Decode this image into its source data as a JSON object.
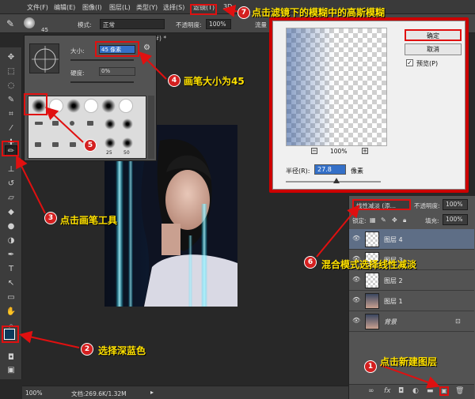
{
  "menubar": {
    "items": [
      "文件(F)",
      "编辑(E)",
      "图像(I)",
      "图层(L)",
      "类型(Y)",
      "选择(S)",
      "滤镜(T)",
      "3D"
    ]
  },
  "options": {
    "brush_size": "45",
    "mode_label": "模式:",
    "mode_value": "正常",
    "opacity_label": "不透明度:",
    "opacity_value": "100%",
    "flow_label": "流量"
  },
  "document": {
    "tab": "8#) *"
  },
  "brush_panel": {
    "size_label": "大小:",
    "size_value": "45 像素",
    "hardness_label": "硬度:",
    "hardness_value": "0%",
    "sizes": [
      "25",
      "50"
    ]
  },
  "gaussian_dialog": {
    "ok": "确定",
    "cancel": "取消",
    "preview": "预览(P)",
    "zoom": "100%",
    "radius_label": "半径(R):",
    "radius_value": "27.8",
    "radius_unit": "像素"
  },
  "layers_panel": {
    "blend_mode": "线性减淡 (添...",
    "opacity_label": "不透明度:",
    "opacity_value": "100%",
    "lock_label": "锁定:",
    "fill_label": "填充:",
    "fill_value": "100%",
    "layers": [
      {
        "name": "图层 4",
        "selected": true
      },
      {
        "name": "图层 3",
        "selected": false
      },
      {
        "name": "图层 2",
        "selected": false
      },
      {
        "name": "图层 1",
        "selected": false
      },
      {
        "name": "背景",
        "selected": false
      }
    ]
  },
  "status": {
    "zoom": "100%",
    "doc": "文档:269.6K/1.32M"
  },
  "annotations": {
    "n1": "1",
    "t1": "点击新建图层",
    "n2": "2",
    "t2": "选择深蓝色",
    "n3": "3",
    "t3": "点击画笔工具",
    "n4": "4",
    "t4": "画笔大小为45",
    "n5": "5",
    "n6": "6",
    "t6": "混合模式选择线性减淡",
    "n7": "7",
    "t7": "点击滤镜下的模糊中的高斯模糊"
  },
  "colors": {
    "foreground": "#0b3a5a",
    "highlight": "#e01010",
    "note_text": "#ffe100"
  }
}
